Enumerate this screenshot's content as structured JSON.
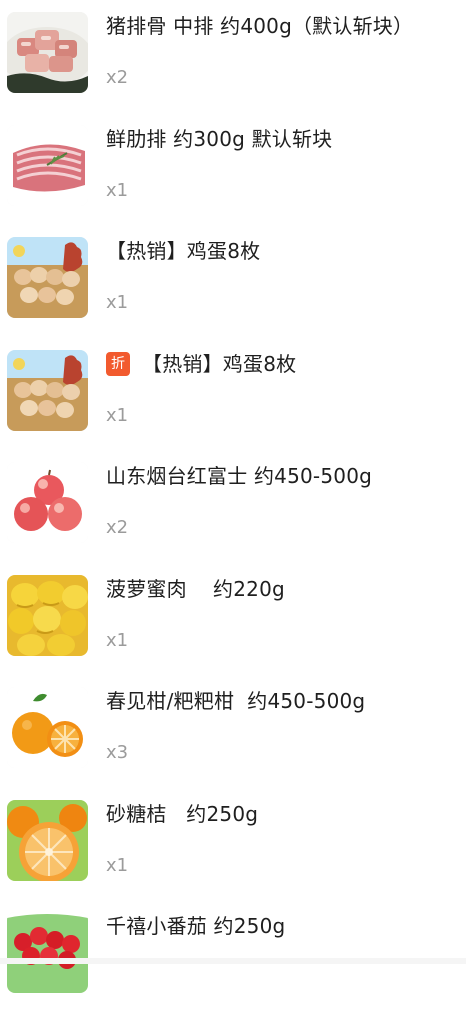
{
  "items": [
    {
      "title": "猪排骨 中排 约400g（默认斩块）",
      "qty": "x2",
      "icon": "pork-spare-ribs-photo"
    },
    {
      "title": "鲜肋排 约300g 默认斩块",
      "qty": "x1",
      "icon": "fresh-ribs-photo"
    },
    {
      "title": "【热销】鸡蛋8枚",
      "qty": "x1",
      "icon": "eggs-photo"
    },
    {
      "title": "【热销】鸡蛋8枚",
      "qty": "x1",
      "icon": "eggs-photo",
      "badge": "折"
    },
    {
      "title": "山东烟台红富士 约450-500g",
      "qty": "x2",
      "icon": "fuji-apple-photo"
    },
    {
      "title": "菠萝蜜肉    约220g",
      "qty": "x1",
      "icon": "jackfruit-photo"
    },
    {
      "title": "春见柑/粑粑柑  约450-500g",
      "qty": "x3",
      "icon": "orange-photo"
    },
    {
      "title": "砂糖桔   约250g",
      "qty": "x1",
      "icon": "mandarin-photo"
    },
    {
      "title": "千禧小番茄 约250g",
      "qty": "",
      "icon": "cherry-tomato-photo"
    }
  ],
  "colors": {
    "promo_badge": "#f25a2e",
    "qty_text": "#9b9b9b",
    "title_text": "#1f1f1f"
  }
}
